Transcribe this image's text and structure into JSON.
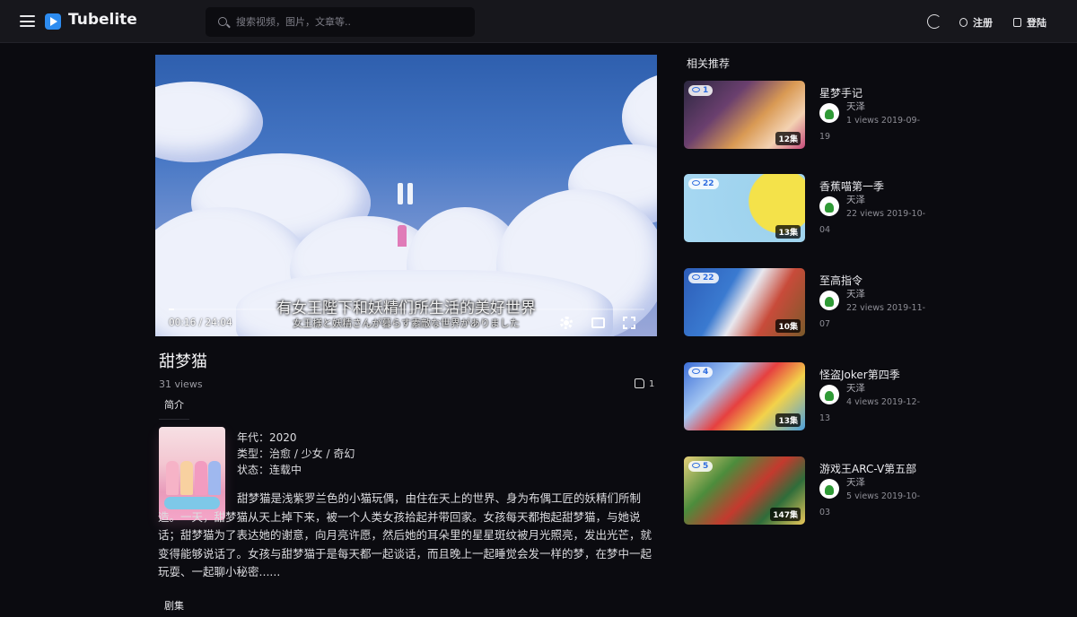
{
  "header": {
    "logo": "Tubelite",
    "search_placeholder": "搜索视频，图片，文章等..",
    "register": "注册",
    "login": "登陆"
  },
  "player": {
    "subtitle_main": "有女王陛下和妖精们所生活的美好世界",
    "subtitle_jp": "女王様と妖精さんが暮らす素敵な世界がありました",
    "time": "00:16 / 24:04",
    "progress": 0.011
  },
  "video": {
    "title": "甜梦猫",
    "views": "31 views",
    "likes": "1",
    "tab_intro": "简介",
    "tab_episodes": "剧集",
    "year": "年代：2020",
    "genre": "类型：治愈 / 少女 / 奇幻",
    "status": "状态：连载中",
    "description": "甜梦猫是浅紫罗兰色的小猫玩偶，由住在天上的世界、身为布偶工匠的妖精们所制造。一天，甜梦猫从天上掉下来，被一个人类女孩拾起并带回家。女孩每天都抱起甜梦猫，与她说话；甜梦猫为了表达她的谢意，向月亮许愿，然后她的耳朵里的星星斑纹被月光照亮，发出光芒，就变得能够说话了。女孩与甜梦猫于是每天都一起谈话，而且晚上一起睡觉会发一样的梦，在梦中一起玩耍、一起聊小秘密......"
  },
  "sidebar": {
    "title": "相关推荐",
    "items": [
      {
        "title": "星梦手记",
        "author": "天泽",
        "views_badge": "1",
        "episodes": "12集",
        "meta": "1 views   2019-09-19"
      },
      {
        "title": "香蕉喵第一季",
        "author": "天泽",
        "views_badge": "22",
        "episodes": "13集",
        "meta": "22 views   2019-10-04"
      },
      {
        "title": "至高指令",
        "author": "天泽",
        "views_badge": "22",
        "episodes": "10集",
        "meta": "22 views   2019-11-07"
      },
      {
        "title": "怪盗Joker第四季",
        "author": "天泽",
        "views_badge": "4",
        "episodes": "13集",
        "meta": "4 views   2019-12-13"
      },
      {
        "title": "游戏王ARC-V第五部",
        "author": "天泽",
        "views_badge": "5",
        "episodes": "147集",
        "meta": "5 views   2019-10-03"
      }
    ]
  }
}
